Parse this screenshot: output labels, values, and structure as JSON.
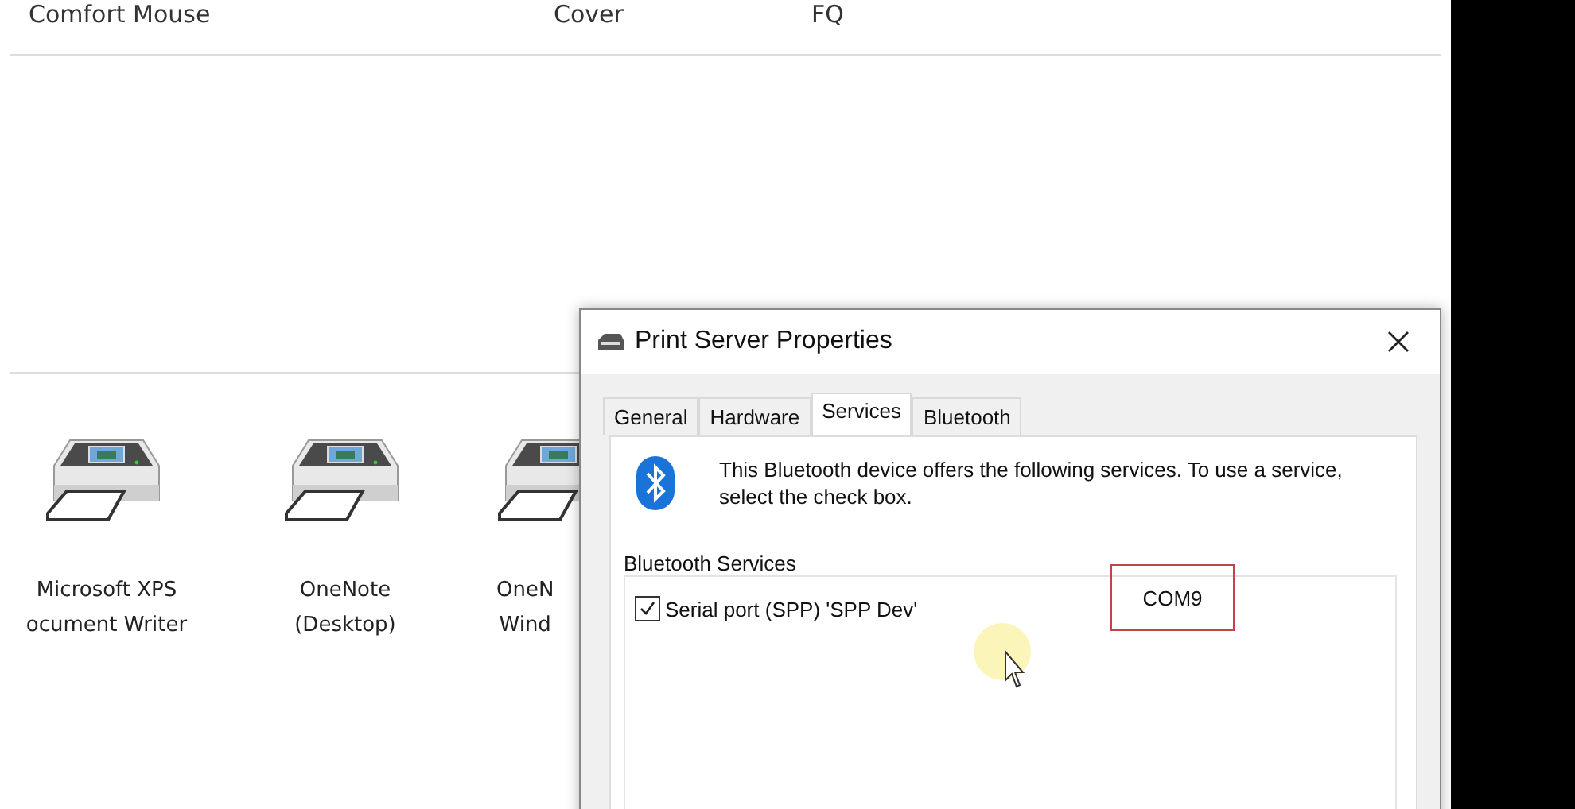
{
  "background": {
    "top_row": [
      "Comfort Mouse",
      "Cover",
      "FQ"
    ],
    "devices": [
      {
        "lines": [
          "Microsoft XPS",
          "ocument Writer"
        ]
      },
      {
        "lines": [
          "OneNote",
          "(Desktop)"
        ]
      },
      {
        "lines": [
          "OneN",
          "Wind"
        ]
      }
    ]
  },
  "dialog": {
    "title": "Print Server Properties",
    "tabs": [
      {
        "label": "General",
        "selected": false
      },
      {
        "label": "Hardware",
        "selected": false
      },
      {
        "label": "Services",
        "selected": true
      },
      {
        "label": "Bluetooth",
        "selected": false
      }
    ],
    "message": "This Bluetooth device offers the following services. To use a service, select the check box.",
    "group_label": "Bluetooth Services",
    "services": [
      {
        "label": "Serial port (SPP) 'SPP Dev'",
        "checked": true,
        "port": "COM9"
      }
    ]
  }
}
